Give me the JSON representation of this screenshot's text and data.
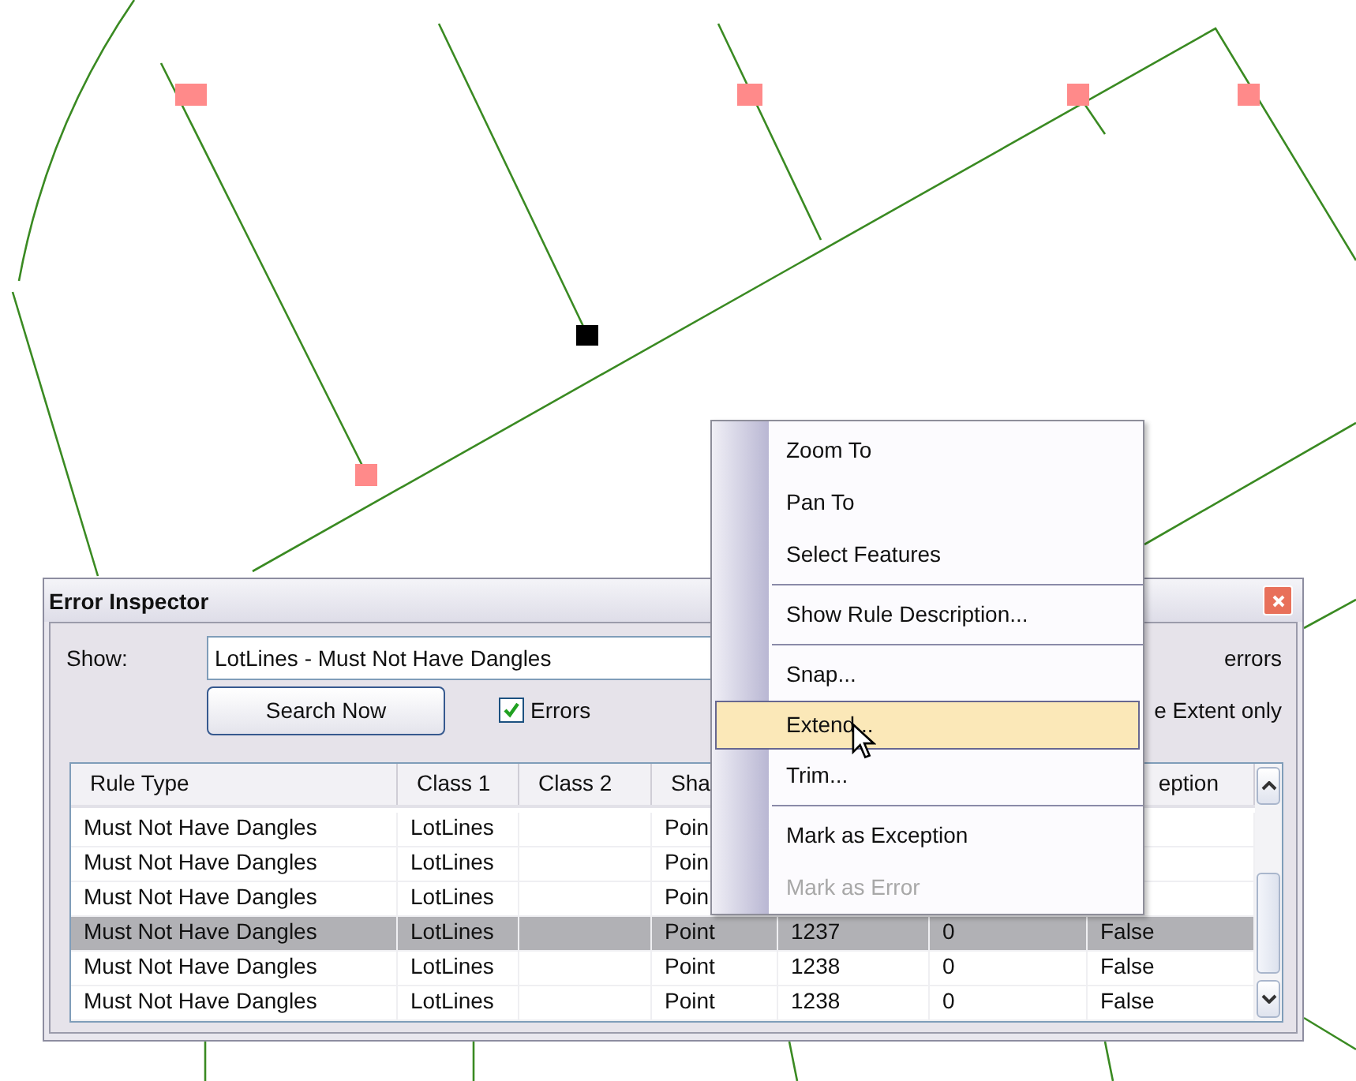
{
  "dialog": {
    "title": "Error Inspector",
    "show_label": "Show:",
    "show_value": "LotLines - Must Not Have Dangles",
    "errors_text": "errors",
    "search_button": "Search Now",
    "errors_checkbox": {
      "label": "Errors",
      "checked": true
    },
    "extent_text": "e Extent only",
    "table": {
      "columns": [
        {
          "label": "Rule Type"
        },
        {
          "label": "Class 1"
        },
        {
          "label": "Class 2"
        },
        {
          "label": "Sha"
        },
        {},
        {},
        {
          "label": "eption"
        }
      ],
      "rows": [
        {
          "selected": false,
          "rule_type": "Must Not Have Dangles",
          "class_1": "LotLines",
          "shape": "Poin"
        },
        {
          "selected": false,
          "rule_type": "Must Not Have Dangles",
          "class_1": "LotLines",
          "shape": "Poin"
        },
        {
          "selected": false,
          "rule_type": "Must Not Have Dangles",
          "class_1": "LotLines",
          "shape": "Poin"
        },
        {
          "selected": true,
          "rule_type": "Must Not Have Dangles",
          "class_1": "LotLines",
          "shape": "Point",
          "column_5": "1237",
          "column_6": "0",
          "exception": "False"
        },
        {
          "selected": false,
          "rule_type": "Must Not Have Dangles",
          "class_1": "LotLines",
          "shape": "Point",
          "column_5": "1238",
          "column_6": "0",
          "exception": "False"
        },
        {
          "selected": false,
          "rule_type": "Must Not Have Dangles",
          "class_1": "LotLines",
          "shape": "Point",
          "column_5": "1238",
          "column_6": "0",
          "exception": "False"
        }
      ]
    }
  },
  "context_menu": [
    {
      "kind": "item",
      "label": "Zoom To",
      "selected": false,
      "disabled": false
    },
    {
      "kind": "item",
      "label": "Pan To",
      "selected": false,
      "disabled": false
    },
    {
      "kind": "item",
      "label": "Select Features",
      "selected": false,
      "disabled": false
    },
    {
      "kind": "separator"
    },
    {
      "kind": "item",
      "label": "Show Rule Description...",
      "selected": false,
      "disabled": false
    },
    {
      "kind": "separator"
    },
    {
      "kind": "item",
      "label": "Snap...",
      "selected": false,
      "disabled": false
    },
    {
      "kind": "item",
      "label": "Extend...",
      "selected": true,
      "disabled": false
    },
    {
      "kind": "item",
      "label": "Trim...",
      "selected": false,
      "disabled": false
    },
    {
      "kind": "separator"
    },
    {
      "kind": "item",
      "label": "Mark as Exception",
      "selected": false,
      "disabled": false
    },
    {
      "kind": "item",
      "label": "Mark as Error",
      "selected": false,
      "disabled": true
    }
  ]
}
